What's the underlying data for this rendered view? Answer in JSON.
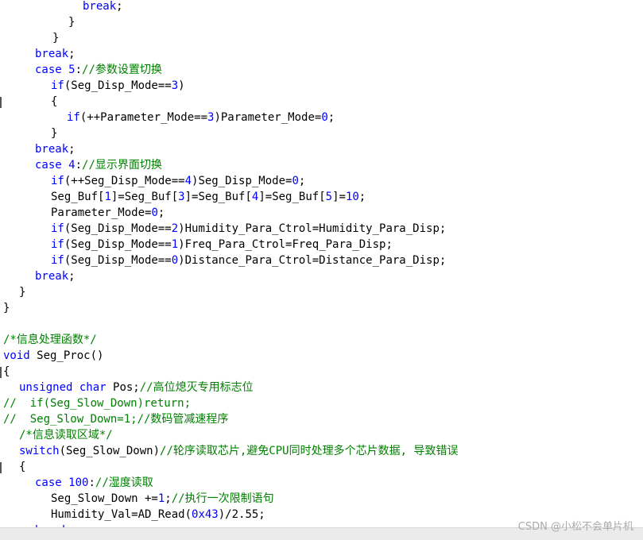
{
  "editor": {
    "lines": [
      [
        {
          "c": "kw",
          "t": "break"
        },
        {
          "c": "",
          "t": ";"
        }
      ],
      [
        {
          "c": "",
          "t": "}"
        }
      ],
      [
        {
          "c": "",
          "t": "}"
        }
      ],
      [
        {
          "c": "kw",
          "t": "break"
        },
        {
          "c": "",
          "t": ";"
        }
      ],
      [
        {
          "c": "kw",
          "t": "case"
        },
        {
          "c": "",
          "t": " "
        },
        {
          "c": "num",
          "t": "5"
        },
        {
          "c": "",
          "t": ":"
        },
        {
          "c": "cm",
          "t": "//参数设置切换"
        }
      ],
      [
        {
          "c": "kw",
          "t": "if"
        },
        {
          "c": "",
          "t": "(Seg_Disp_Mode=="
        },
        {
          "c": "num",
          "t": "3"
        },
        {
          "c": "",
          "t": ")"
        }
      ],
      [
        {
          "c": "",
          "t": "{"
        }
      ],
      [
        {
          "c": "kw",
          "t": "if"
        },
        {
          "c": "",
          "t": "(++Parameter_Mode=="
        },
        {
          "c": "num",
          "t": "3"
        },
        {
          "c": "",
          "t": ")Parameter_Mode="
        },
        {
          "c": "num",
          "t": "0"
        },
        {
          "c": "",
          "t": ";"
        }
      ],
      [
        {
          "c": "",
          "t": "}"
        }
      ],
      [
        {
          "c": "kw",
          "t": "break"
        },
        {
          "c": "",
          "t": ";"
        }
      ],
      [
        {
          "c": "kw",
          "t": "case"
        },
        {
          "c": "",
          "t": " "
        },
        {
          "c": "num",
          "t": "4"
        },
        {
          "c": "",
          "t": ":"
        },
        {
          "c": "cm",
          "t": "//显示界面切换"
        }
      ],
      [
        {
          "c": "kw",
          "t": "if"
        },
        {
          "c": "",
          "t": "(++Seg_Disp_Mode=="
        },
        {
          "c": "num",
          "t": "4"
        },
        {
          "c": "",
          "t": ")Seg_Disp_Mode="
        },
        {
          "c": "num",
          "t": "0"
        },
        {
          "c": "",
          "t": ";"
        }
      ],
      [
        {
          "c": "",
          "t": "Seg_Buf["
        },
        {
          "c": "num",
          "t": "1"
        },
        {
          "c": "",
          "t": "]=Seg_Buf["
        },
        {
          "c": "num",
          "t": "3"
        },
        {
          "c": "",
          "t": "]=Seg_Buf["
        },
        {
          "c": "num",
          "t": "4"
        },
        {
          "c": "",
          "t": "]=Seg_Buf["
        },
        {
          "c": "num",
          "t": "5"
        },
        {
          "c": "",
          "t": "]="
        },
        {
          "c": "num",
          "t": "10"
        },
        {
          "c": "",
          "t": ";"
        }
      ],
      [
        {
          "c": "",
          "t": "Parameter_Mode="
        },
        {
          "c": "num",
          "t": "0"
        },
        {
          "c": "",
          "t": ";"
        }
      ],
      [
        {
          "c": "kw",
          "t": "if"
        },
        {
          "c": "",
          "t": "(Seg_Disp_Mode=="
        },
        {
          "c": "num",
          "t": "2"
        },
        {
          "c": "",
          "t": ")Humidity_Para_Ctrol=Humidity_Para_Disp;"
        }
      ],
      [
        {
          "c": "kw",
          "t": "if"
        },
        {
          "c": "",
          "t": "(Seg_Disp_Mode=="
        },
        {
          "c": "num",
          "t": "1"
        },
        {
          "c": "",
          "t": ")Freq_Para_Ctrol=Freq_Para_Disp;"
        }
      ],
      [
        {
          "c": "kw",
          "t": "if"
        },
        {
          "c": "",
          "t": "(Seg_Disp_Mode=="
        },
        {
          "c": "num",
          "t": "0"
        },
        {
          "c": "",
          "t": ")Distance_Para_Ctrol=Distance_Para_Disp;"
        }
      ],
      [
        {
          "c": "kw",
          "t": "break"
        },
        {
          "c": "",
          "t": ";"
        }
      ],
      [
        {
          "c": "",
          "t": "}"
        }
      ],
      [
        {
          "c": "",
          "t": "}"
        }
      ],
      [],
      [
        {
          "c": "cm",
          "t": "/*信息处理函数*/"
        }
      ],
      [
        {
          "c": "kw",
          "t": "void"
        },
        {
          "c": "",
          "t": " Seg_Proc()"
        }
      ],
      [
        {
          "c": "",
          "t": "{"
        }
      ],
      [
        {
          "c": "kw",
          "t": "unsigned"
        },
        {
          "c": "",
          "t": " "
        },
        {
          "c": "kw",
          "t": "char"
        },
        {
          "c": "",
          "t": " Pos;"
        },
        {
          "c": "cm",
          "t": "//高位熄灭专用标志位"
        }
      ],
      [
        {
          "c": "cm",
          "t": "//  if(Seg_Slow_Down)return;"
        }
      ],
      [
        {
          "c": "cm",
          "t": "//  Seg_Slow_Down=1;//数码管减速程序"
        }
      ],
      [
        {
          "c": "cm",
          "t": "/*信息读取区域*/"
        }
      ],
      [
        {
          "c": "kw",
          "t": "switch"
        },
        {
          "c": "",
          "t": "(Seg_Slow_Down)"
        },
        {
          "c": "cm",
          "t": "//轮序读取芯片,避免CPU同时处理多个芯片数据, 导致错误"
        }
      ],
      [
        {
          "c": "",
          "t": "{"
        }
      ],
      [
        {
          "c": "kw",
          "t": "case"
        },
        {
          "c": "",
          "t": " "
        },
        {
          "c": "num",
          "t": "100"
        },
        {
          "c": "",
          "t": ":"
        },
        {
          "c": "cm",
          "t": "//湿度读取"
        }
      ],
      [
        {
          "c": "",
          "t": "Seg_Slow_Down +="
        },
        {
          "c": "num",
          "t": "1"
        },
        {
          "c": "",
          "t": ";"
        },
        {
          "c": "cm",
          "t": "//执行一次限制语句"
        }
      ],
      [
        {
          "c": "",
          "t": "Humidity_Val=AD_Read("
        },
        {
          "c": "num",
          "t": "0x43"
        },
        {
          "c": "",
          "t": ")/2.55;"
        }
      ],
      [
        {
          "c": "kw",
          "t": "break"
        },
        {
          "c": "",
          "t": ";"
        }
      ]
    ]
  },
  "watermark": "CSDN @小松不会单片机"
}
